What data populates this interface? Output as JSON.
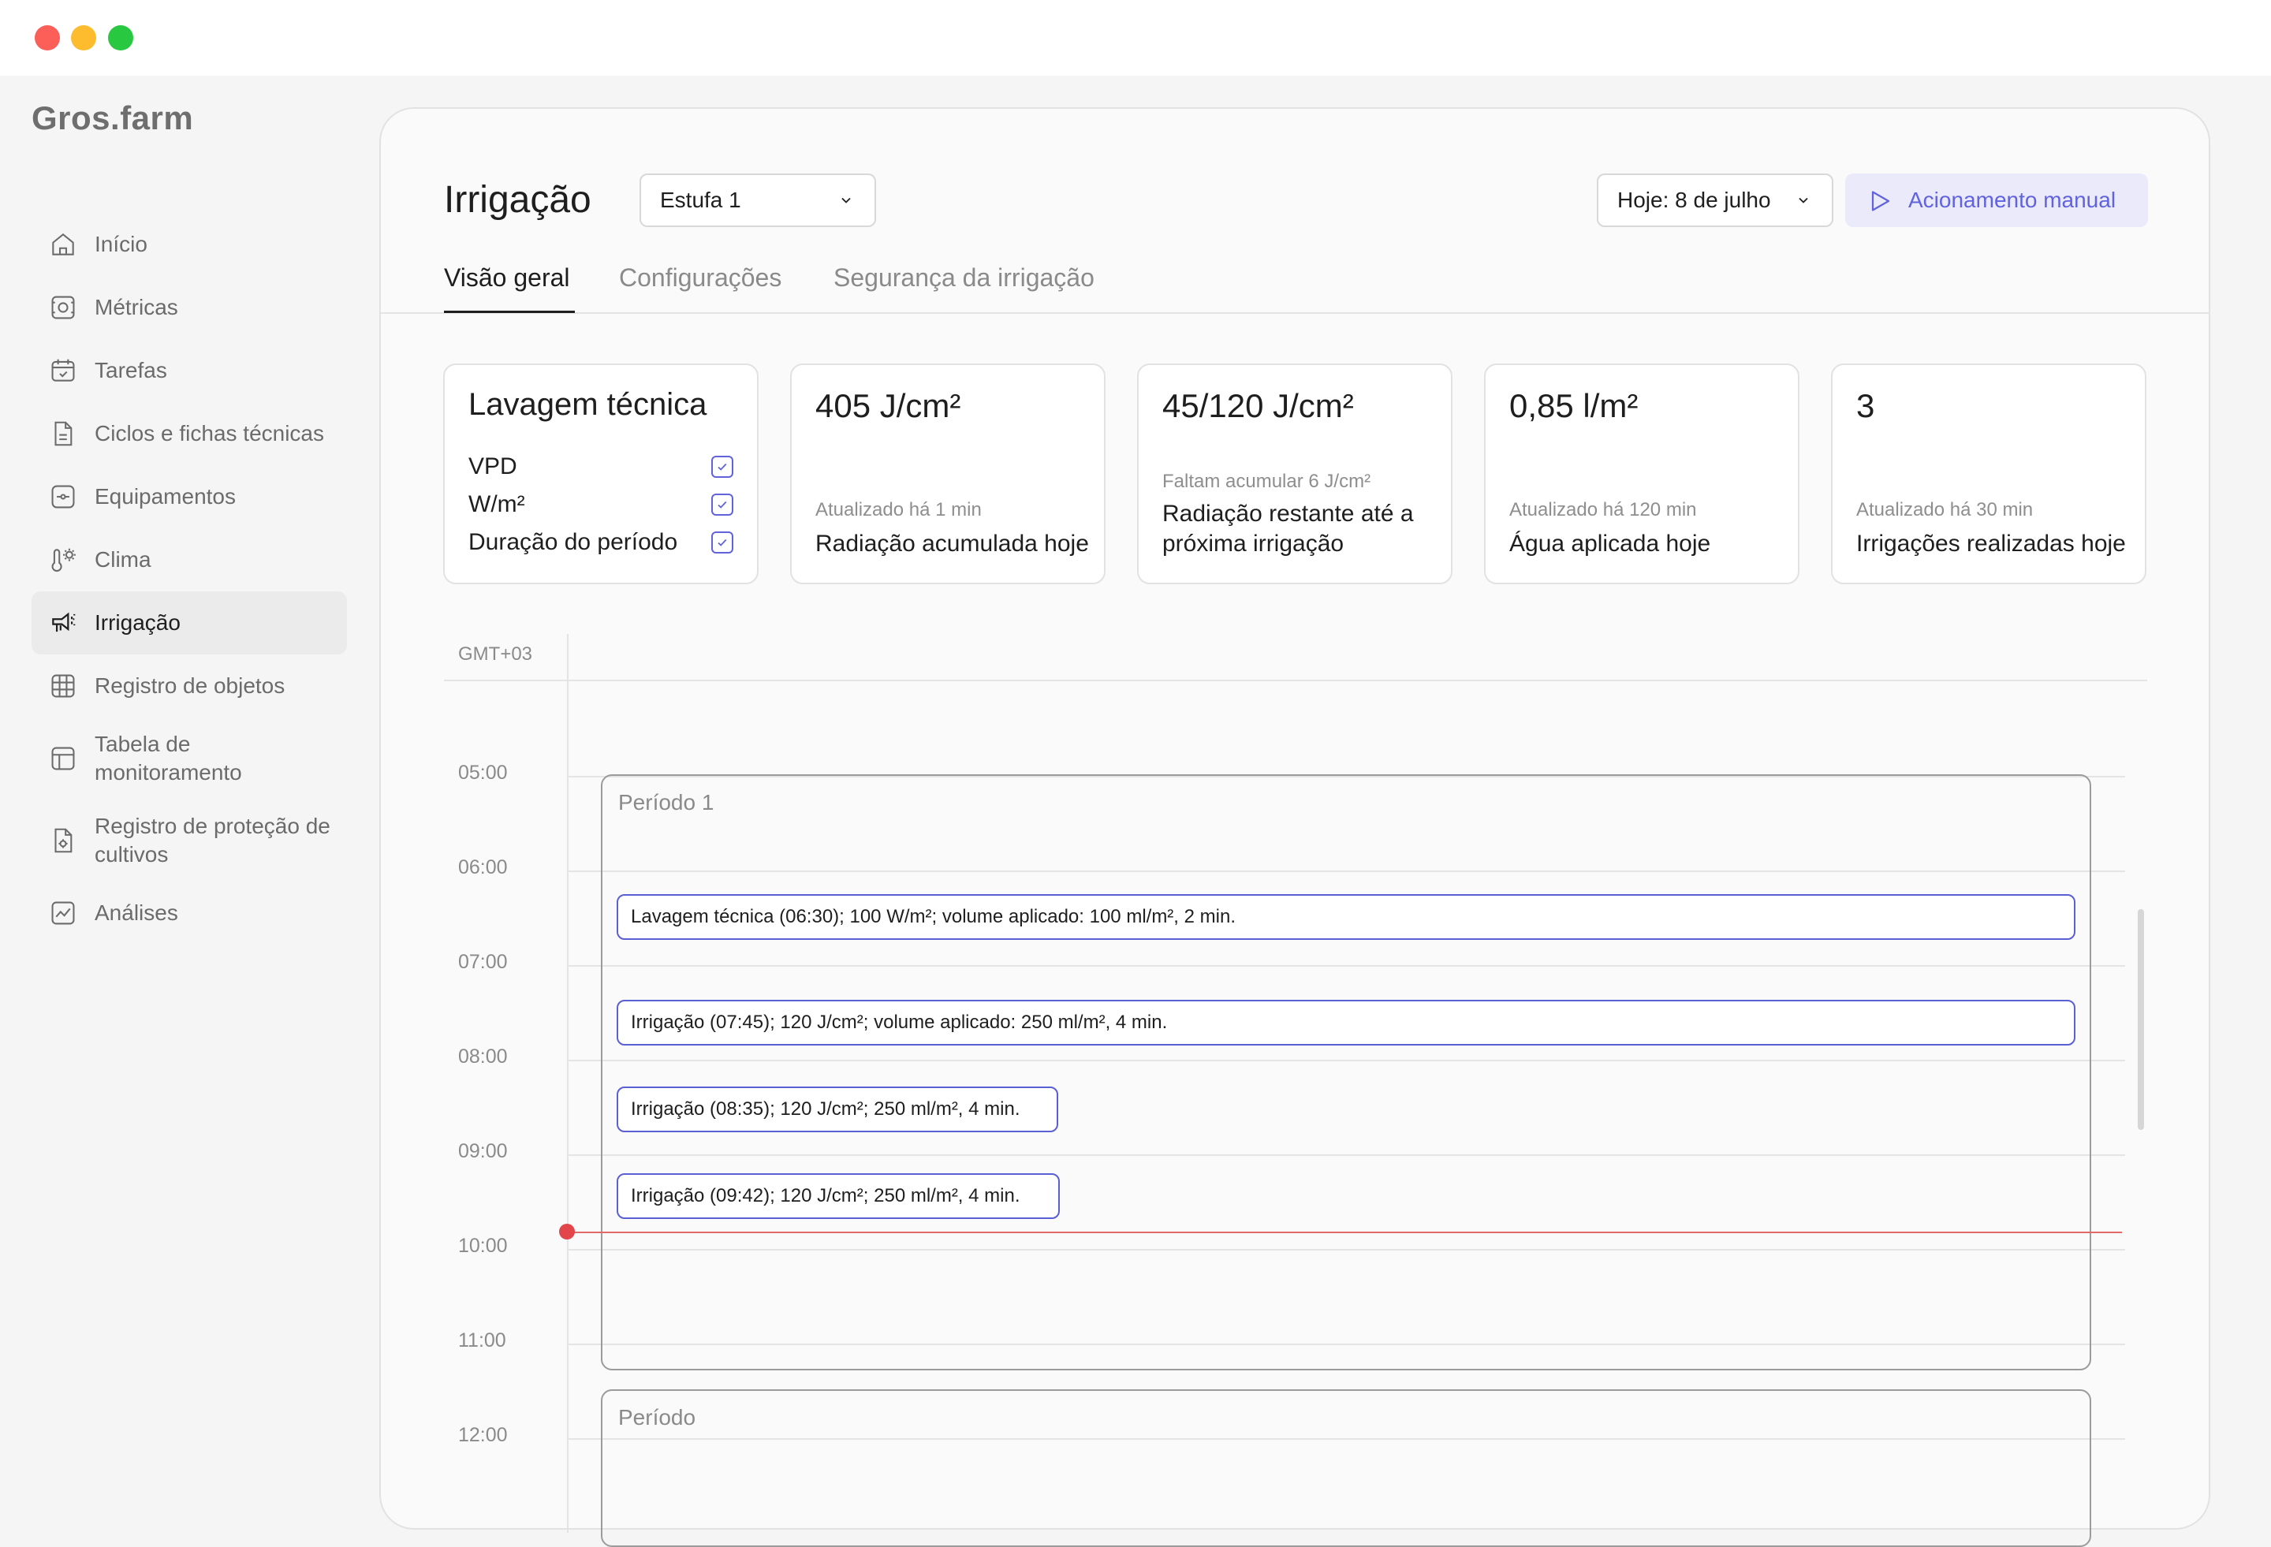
{
  "window": {
    "controls": [
      "close",
      "minimize",
      "maximize"
    ],
    "colors": {
      "close": "#fc5f57",
      "minimize": "#fdbc2e",
      "maximize": "#28c840"
    }
  },
  "brand": {
    "logo": "Gros.farm"
  },
  "sidebar": {
    "items": [
      {
        "label": "Início",
        "icon": "home-icon",
        "active": false
      },
      {
        "label": "Métricas",
        "icon": "metrics-icon",
        "active": false
      },
      {
        "label": "Tarefas",
        "icon": "calendar-check-icon",
        "active": false
      },
      {
        "label": "Ciclos e fichas técnicas",
        "icon": "document-icon",
        "active": false
      },
      {
        "label": "Equipamentos",
        "icon": "equipment-icon",
        "active": false
      },
      {
        "label": "Clima",
        "icon": "thermometer-sun-icon",
        "active": false
      },
      {
        "label": "Irrigação",
        "icon": "irrigation-icon",
        "active": true
      },
      {
        "label": "Registro de objetos",
        "icon": "grid-icon",
        "active": false
      },
      {
        "label": "Tabela de monitoramento",
        "icon": "table-icon",
        "active": false
      },
      {
        "label": "Registro de proteção de cultivos",
        "icon": "shield-document-icon",
        "active": false
      },
      {
        "label": "Análises",
        "icon": "chart-icon",
        "active": false
      }
    ]
  },
  "header": {
    "title": "Irrigação",
    "greenhouse_select": "Estufa 1",
    "date_select": "Hoje: 8 de julho",
    "manual_button": "Acionamento manual",
    "accent_color": "#6063dd"
  },
  "tabs": [
    {
      "label": "Visão geral",
      "active": true
    },
    {
      "label": "Configurações",
      "active": false
    },
    {
      "label": "Segurança da irrigação",
      "active": false
    }
  ],
  "cards": {
    "wash": {
      "title": "Lavagem técnica",
      "items": [
        {
          "label": "VPD",
          "checked": true
        },
        {
          "label": "W/m²",
          "checked": true
        },
        {
          "label": "Duração do período",
          "checked": true
        }
      ]
    },
    "radiation": {
      "value": "405 J/cm²",
      "sub": "Atualizado há 1 min",
      "label": "Radiação acumulada hoje"
    },
    "remaining": {
      "value": "45/120 J/cm²",
      "sub": "Faltam acumular 6 J/cm²",
      "label": "Radiação restante até a próxima irrigação"
    },
    "water": {
      "value": "0,85 l/m²",
      "sub": "Atualizado há 120 min",
      "label": "Água aplicada hoje"
    },
    "count": {
      "value": "3",
      "sub": "Atualizado há 30 min",
      "label": "Irrigações realizadas hoje"
    }
  },
  "calendar": {
    "timezone": "GMT+03",
    "hours": [
      "05:00",
      "06:00",
      "07:00",
      "08:00",
      "09:00",
      "10:00",
      "11:00",
      "12:00"
    ],
    "periods": [
      {
        "title": "Período 1"
      },
      {
        "title": "Período"
      }
    ],
    "events": [
      {
        "text": "Lavagem técnica (06:30); 100 W/m²; volume aplicado: 100 ml/m², 2 min."
      },
      {
        "text": "Irrigação (07:45); 120 J/cm²; volume aplicado: 250 ml/m², 4 min."
      },
      {
        "text": "Irrigação (08:35); 120 J/cm²; 250 ml/m², 4 min."
      },
      {
        "text": "Irrigação (09:42); 120 J/cm²; 250 ml/m², 4 min."
      }
    ],
    "now_color": "#e2454a"
  }
}
